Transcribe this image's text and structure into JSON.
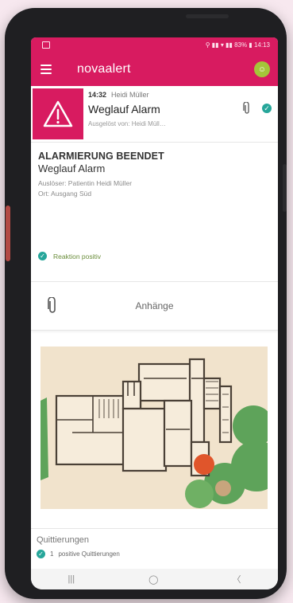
{
  "status": {
    "icons": "⚲ ▮▮ ▾ ▮▮ 83% ▮",
    "time": "14:13"
  },
  "appbar": {
    "title": "novaalert",
    "avatar_icon": "smiley-icon"
  },
  "alarm": {
    "time": "14:32",
    "person": "Heidi Müller",
    "name": "Weglauf Alarm",
    "subtitle": "Ausgelöst von: Heidi Müll…"
  },
  "detail": {
    "heading": "ALARMIERUNG BEENDET",
    "name": "Weglauf Alarm",
    "trigger": "Auslöser: Patientin Heidi Müller",
    "location": "Ort: Ausgang Süd",
    "reaction": "Reaktion positiv"
  },
  "attachments": {
    "label": "Anhänge"
  },
  "acknowledgements": {
    "title": "Quittierungen",
    "count": "1",
    "text": "positive Quittierungen"
  },
  "navbar": {
    "recent": "|||",
    "home": "◯",
    "back": "〈"
  },
  "colors": {
    "brand": "#d81b60",
    "check": "#26a69a",
    "map_bg": "#f1e3cc",
    "marker": "#e0552b"
  }
}
